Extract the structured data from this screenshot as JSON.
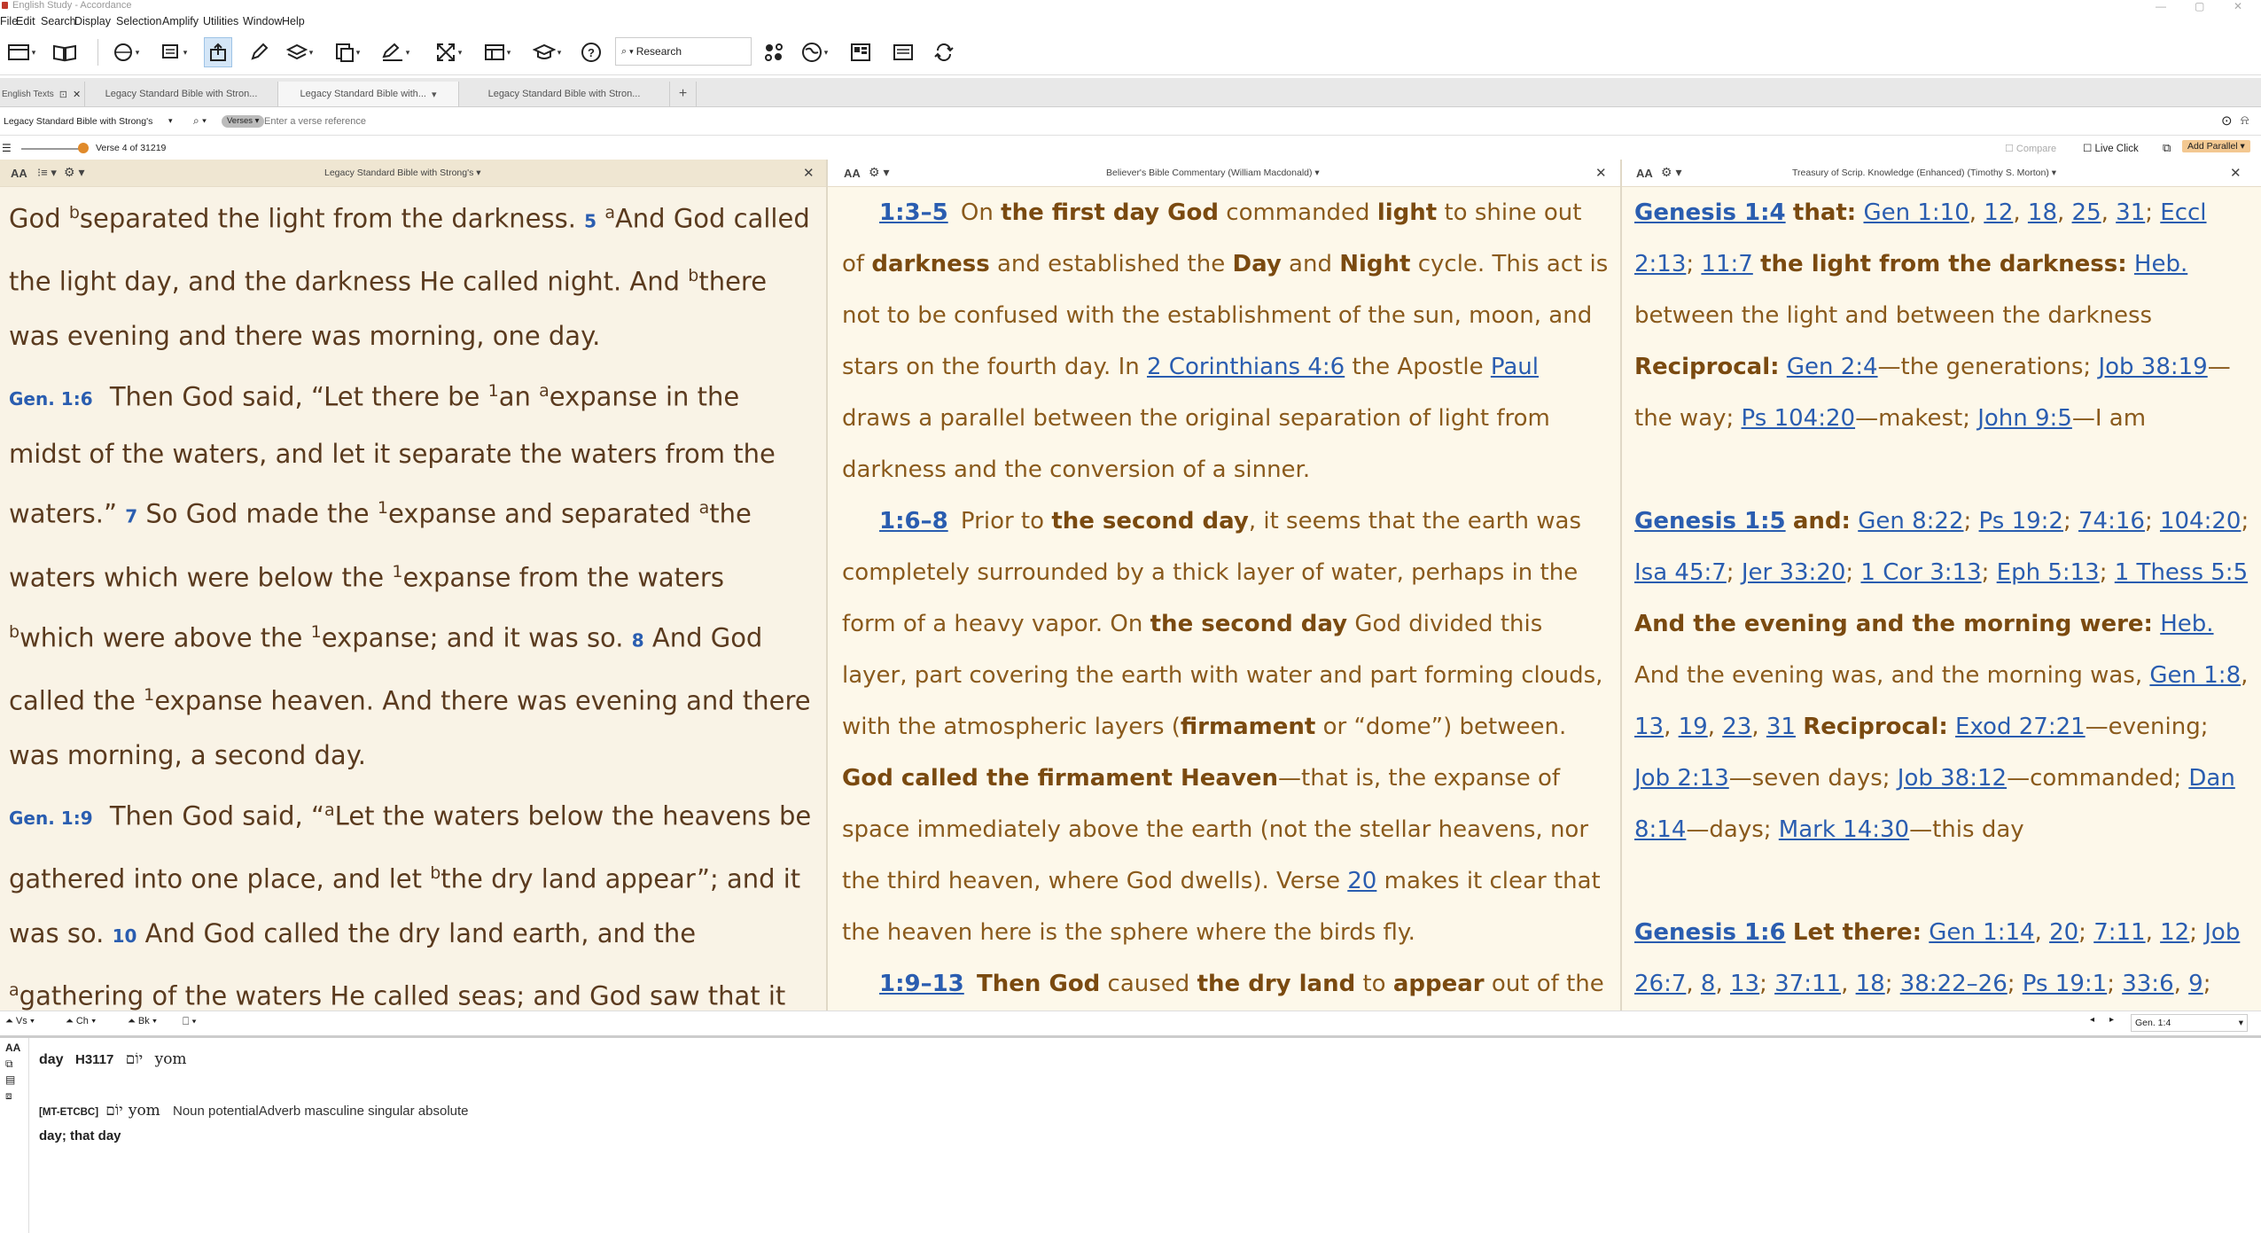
{
  "window": {
    "title": "English Study - Accordance"
  },
  "menu": [
    "File",
    "Edit",
    "Search",
    "Display",
    "Selection",
    "Amplify",
    "Utilities",
    "Window",
    "Help"
  ],
  "toolbar": {
    "research_label": "Research"
  },
  "tabs": {
    "group_label": "English Texts",
    "items": [
      {
        "label": "Legacy Standard Bible with Stron..."
      },
      {
        "label": "Legacy Standard Bible with..."
      },
      {
        "label": "Legacy Standard Bible with Stron..."
      }
    ],
    "add": "+"
  },
  "search": {
    "module": "Legacy Standard Bible with Strong's",
    "mode": "Verses",
    "placeholder": "Enter a verse reference"
  },
  "verse_nav": {
    "position": "Verse 4 of 31219",
    "slider_fraction": 0.0001
  },
  "options": {
    "compare": "Compare",
    "live_click": "Live Click",
    "add_parallel": "Add Parallel"
  },
  "pane1": {
    "title": "Legacy Standard Bible with Strong's",
    "font_btn": "AA"
  },
  "pane2": {
    "title": "Believer's Bible Commentary (William Macdonald)",
    "font_btn": "AA"
  },
  "pane3": {
    "title": "Treasury of Scrip. Knowledge (Enhanced) (Timothy S. Morton)",
    "font_btn": "AA"
  },
  "bottom_nav": {
    "vs": "Vs",
    "ch": "Ch",
    "bk": "Bk",
    "reference": "Gen. 1:4"
  },
  "lexicon": {
    "font_btn": "AA",
    "word": "day",
    "strongs": "H3117",
    "hebrew": "יוֹם",
    "translit": "yom",
    "source": "[MT-ETCBC]",
    "hebrew2": "יוֹם",
    "translit2": "yom",
    "parsing": "Noun potentialAdverb masculine singular absolute",
    "gloss": "day; that day"
  },
  "colors": {
    "bible_bg": "#f9f3e6",
    "comm_bg": "#fdf8ea",
    "text_brown": "#8a5a1c",
    "link_blue": "#2a5db0",
    "add_parallel_bg": "#f3c891"
  }
}
